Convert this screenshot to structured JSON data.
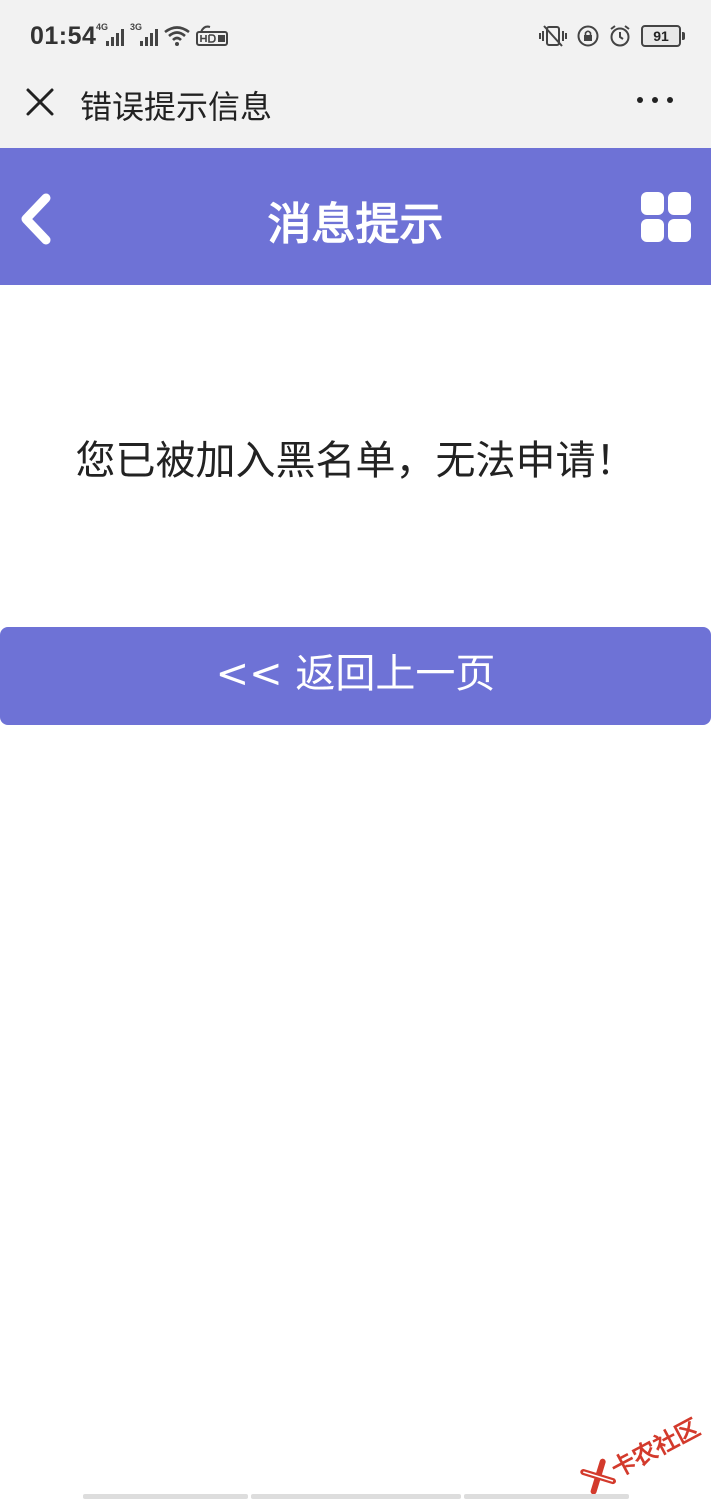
{
  "status_bar": {
    "time": "01:54",
    "signal_1_label": "4G",
    "signal_2_label": "3G",
    "battery": "91"
  },
  "wx_header": {
    "title": "错误提示信息"
  },
  "nav": {
    "title": "消息提示"
  },
  "message": "您已被加入黑名单，无法申请！",
  "back_button_label": "<< 返回上一页",
  "watermark": "卡农社区",
  "colors": {
    "accent": "#6e72d6",
    "header_bg": "#f2f2f2",
    "watermark_red": "#d33a2c"
  }
}
